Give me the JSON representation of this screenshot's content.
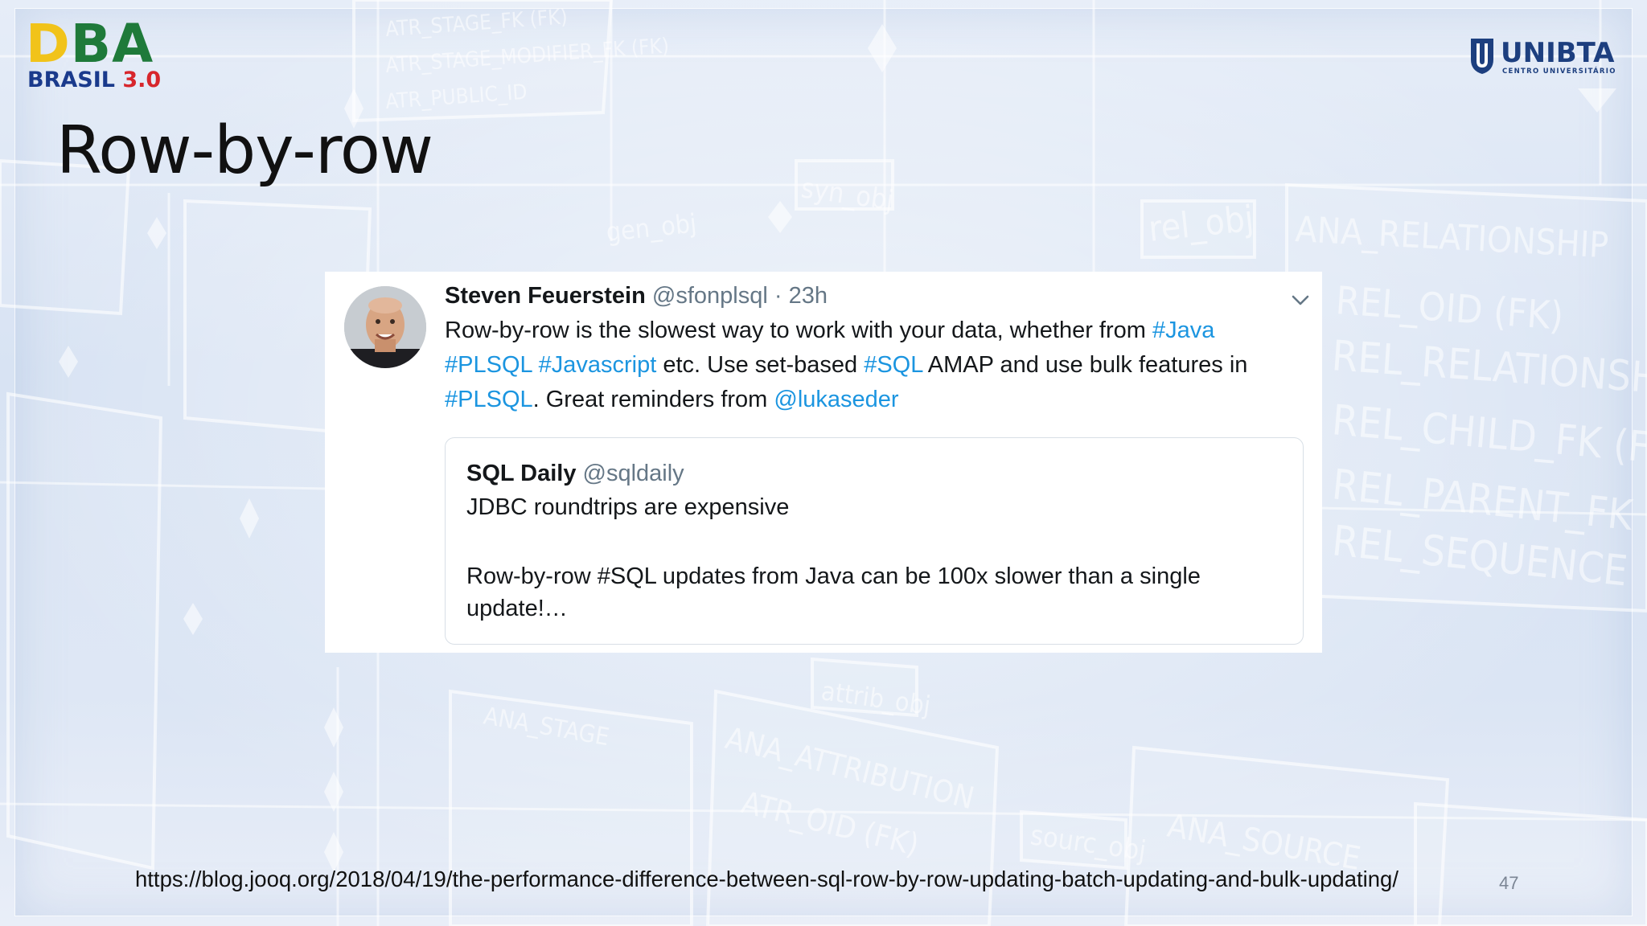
{
  "slide": {
    "title": "Row-by-row",
    "footer_url": "https://blog.jooq.org/2018/04/19/the-performance-difference-between-sql-row-by-row-updating-batch-updating-and-bulk-updating/",
    "page_number": "47"
  },
  "logos": {
    "dba": {
      "top_d": "D",
      "top_b": "B",
      "top_a": "A",
      "bottom_text": "BRASIL ",
      "bottom_version": "3.0"
    },
    "unibta": {
      "name": "UNIBTA",
      "subtitle": "CENTRO UNIVERSITÁRIO"
    }
  },
  "tweet": {
    "author_name": "Steven Feuerstein",
    "author_handle": "@sfonplsql",
    "separator": " · ",
    "time": "23h",
    "text_parts": [
      {
        "t": "Row-by-row is the slowest way to work with your data, whether from ",
        "link": false
      },
      {
        "t": "#Java",
        "link": true
      },
      {
        "t": " ",
        "link": false
      },
      {
        "t": "#PLSQL",
        "link": true
      },
      {
        "t": " ",
        "link": false
      },
      {
        "t": "#Javascript",
        "link": true
      },
      {
        "t": " etc. Use set-based ",
        "link": false
      },
      {
        "t": "#SQL",
        "link": true
      },
      {
        "t": " AMAP and use bulk features in ",
        "link": false
      },
      {
        "t": "#PLSQL",
        "link": true
      },
      {
        "t": ". Great reminders from ",
        "link": false
      },
      {
        "t": "@lukaseder",
        "link": true
      }
    ],
    "quoted": {
      "name": "SQL Daily",
      "handle": "@sqldaily",
      "line1": "JDBC roundtrips are expensive",
      "line2": "Row-by-row #SQL updates from Java can be 100x slower than a single update!…"
    },
    "menu_icon": "chevron-down-icon"
  },
  "background_labels": [
    "ATR_STAGE_FK (FK)",
    "ATR_STAGE_MODIFIER_FK (FK)",
    "ATR_PUBLIC_ID",
    "syn_obj",
    "gen_obj",
    "rel_obj",
    "ANA_RELATIONSHIP",
    "REL_OID (FK)",
    "REL_RELATIONSHIP",
    "REL_CHILD_FK (FK)",
    "REL_PARENT_FK (FK)",
    "REL_SEQUENCE",
    "ANA_ATTRIBUTION",
    "ATR_OID (FK)",
    "ANA_SOURCE",
    "ANA_STAGE",
    "attrib_obj",
    "sourc_obj"
  ]
}
